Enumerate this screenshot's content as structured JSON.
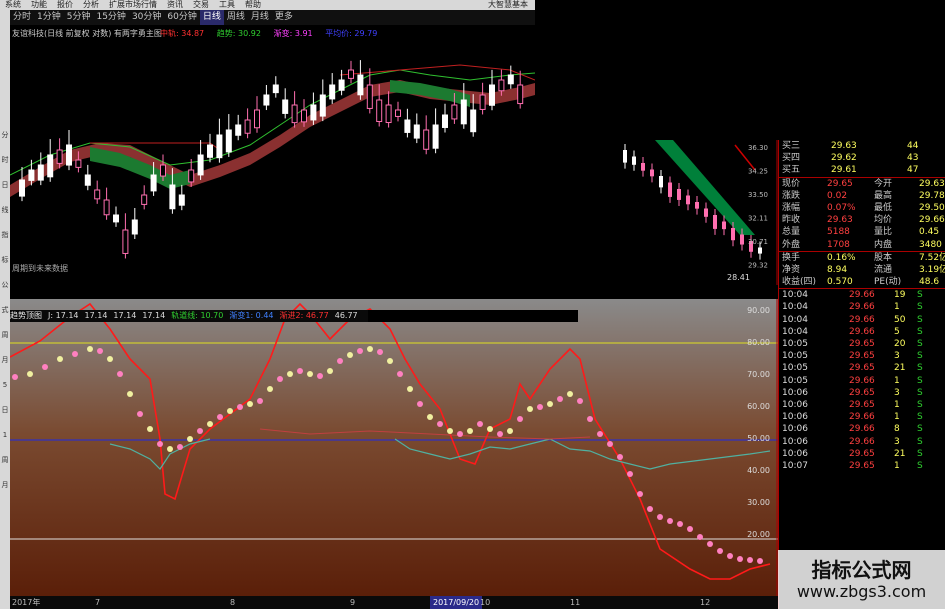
{
  "menubar": [
    "系统",
    "功能",
    "报价",
    "分析",
    "扩展市场行情",
    "资讯",
    "交易",
    "工具",
    "帮助"
  ],
  "menubar_right": "大智慧基本",
  "periods": [
    {
      "label": "分时",
      "active": false
    },
    {
      "label": "1分钟",
      "active": false
    },
    {
      "label": "5分钟",
      "active": false
    },
    {
      "label": "15分钟",
      "active": false
    },
    {
      "label": "30分钟",
      "active": false
    },
    {
      "label": "60分钟",
      "active": false
    },
    {
      "label": "日线",
      "active": true
    },
    {
      "label": "周线",
      "active": false
    },
    {
      "label": "月线",
      "active": false
    },
    {
      "label": "更多",
      "active": false
    }
  ],
  "top_title": "友谊科技(日线 前复权 对数) 有两字勇主图",
  "top_indicators": [
    {
      "label": "中轨: 34.87",
      "color": "#ff3030"
    },
    {
      "label": "趋势: 30.92",
      "color": "#30d030"
    },
    {
      "label": "渐变: 3.91",
      "color": "#ff40ff"
    },
    {
      "label": "平均价: 29.79",
      "color": "#4040ff"
    }
  ],
  "top_footer": "周期到未来数据",
  "lower_title": "趋势顶图",
  "lower_indicators": [
    {
      "label": "J: 17.14",
      "color": "#dddddd"
    },
    {
      "label": "17.14",
      "color": "#dddddd"
    },
    {
      "label": "17.14",
      "color": "#dddddd"
    },
    {
      "label": "17.14",
      "color": "#dddddd"
    },
    {
      "label": "轨道线: 10.70",
      "color": "#30d030"
    },
    {
      "label": "渐变1: 0.44",
      "color": "#4080ff"
    },
    {
      "label": "渐进2: 46.77",
      "color": "#ff3030"
    },
    {
      "label": "46.77",
      "color": "#dddddd"
    }
  ],
  "lower_axis": [
    "90.00",
    "80.00",
    "70.00",
    "60.00",
    "50.00",
    "40.00",
    "30.00",
    "20.00"
  ],
  "mid_axis": [
    "36.30",
    "34.25",
    "33.50",
    "32.11",
    "30.71",
    "29.32"
  ],
  "mid_label": "28.41",
  "dates": [
    "2017年",
    "7",
    "8",
    "9",
    "2017/09/20",
    "10",
    "11",
    "12"
  ],
  "left_labels": [
    "分",
    "时",
    "日",
    "线",
    "指",
    "标",
    "公",
    "式",
    "周",
    "月",
    "5",
    "日",
    "1",
    "周",
    "月"
  ],
  "quote": {
    "bids": [
      {
        "label": "买三",
        "price": "29.63",
        "vol": "44"
      },
      {
        "label": "买四",
        "price": "29.62",
        "vol": "43"
      },
      {
        "label": "买五",
        "price": "29.61",
        "vol": "47"
      }
    ],
    "stats": [
      {
        "l1": "现价",
        "v1": "29.65",
        "l2": "今开",
        "v2": "29.63"
      },
      {
        "l1": "涨跌",
        "v1": "0.02",
        "l2": "最高",
        "v2": "29.78"
      },
      {
        "l1": "涨幅",
        "v1": "0.07%",
        "l2": "最低",
        "v2": "29.50"
      },
      {
        "l1": "昨收",
        "v1": "29.63",
        "l2": "均价",
        "v2": "29.66"
      },
      {
        "l1": "总量",
        "v1": "5188",
        "l2": "量比",
        "v2": "0.45"
      },
      {
        "l1": "外盘",
        "v1": "1708",
        "l2": "内盘",
        "v2": "3480"
      }
    ],
    "stats2": [
      {
        "l1": "换手",
        "v1": "0.16%",
        "l2": "股本",
        "v2": "7.52亿"
      },
      {
        "l1": "净资",
        "v1": "8.94",
        "l2": "流通",
        "v2": "3.19亿"
      },
      {
        "l1": "收益(四)",
        "v1": "0.570",
        "l2": "PE(动)",
        "v2": "48.6"
      }
    ],
    "ticks": [
      {
        "t": "10:04",
        "p": "29.66",
        "v": "19",
        "s": "S"
      },
      {
        "t": "10:04",
        "p": "29.66",
        "v": "1",
        "s": "S"
      },
      {
        "t": "10:04",
        "p": "29.66",
        "v": "50",
        "s": "S"
      },
      {
        "t": "10:04",
        "p": "29.66",
        "v": "5",
        "s": "S"
      },
      {
        "t": "10:05",
        "p": "29.65",
        "v": "20",
        "s": "S"
      },
      {
        "t": "10:05",
        "p": "29.65",
        "v": "3",
        "s": "S"
      },
      {
        "t": "10:05",
        "p": "29.65",
        "v": "21",
        "s": "S"
      },
      {
        "t": "10:05",
        "p": "29.66",
        "v": "1",
        "s": "S"
      },
      {
        "t": "10:06",
        "p": "29.65",
        "v": "3",
        "s": "S"
      },
      {
        "t": "10:06",
        "p": "29.65",
        "v": "1",
        "s": "S"
      },
      {
        "t": "10:06",
        "p": "29.66",
        "v": "1",
        "s": "S"
      },
      {
        "t": "10:06",
        "p": "29.66",
        "v": "8",
        "s": "S"
      },
      {
        "t": "10:06",
        "p": "29.66",
        "v": "3",
        "s": "S"
      },
      {
        "t": "10:06",
        "p": "29.65",
        "v": "21",
        "s": "S"
      },
      {
        "t": "10:07",
        "p": "29.65",
        "v": "1",
        "s": "S"
      }
    ]
  },
  "watermark": {
    "title": "指标公式网",
    "url": "www.zbgs3.com"
  },
  "colors": {
    "up": "#ff5050",
    "down": "#ffffff",
    "ma_green": "#00a040",
    "ma_red": "#c04040",
    "yellow": "#e0e020",
    "rsi_red": "#ff2020"
  }
}
